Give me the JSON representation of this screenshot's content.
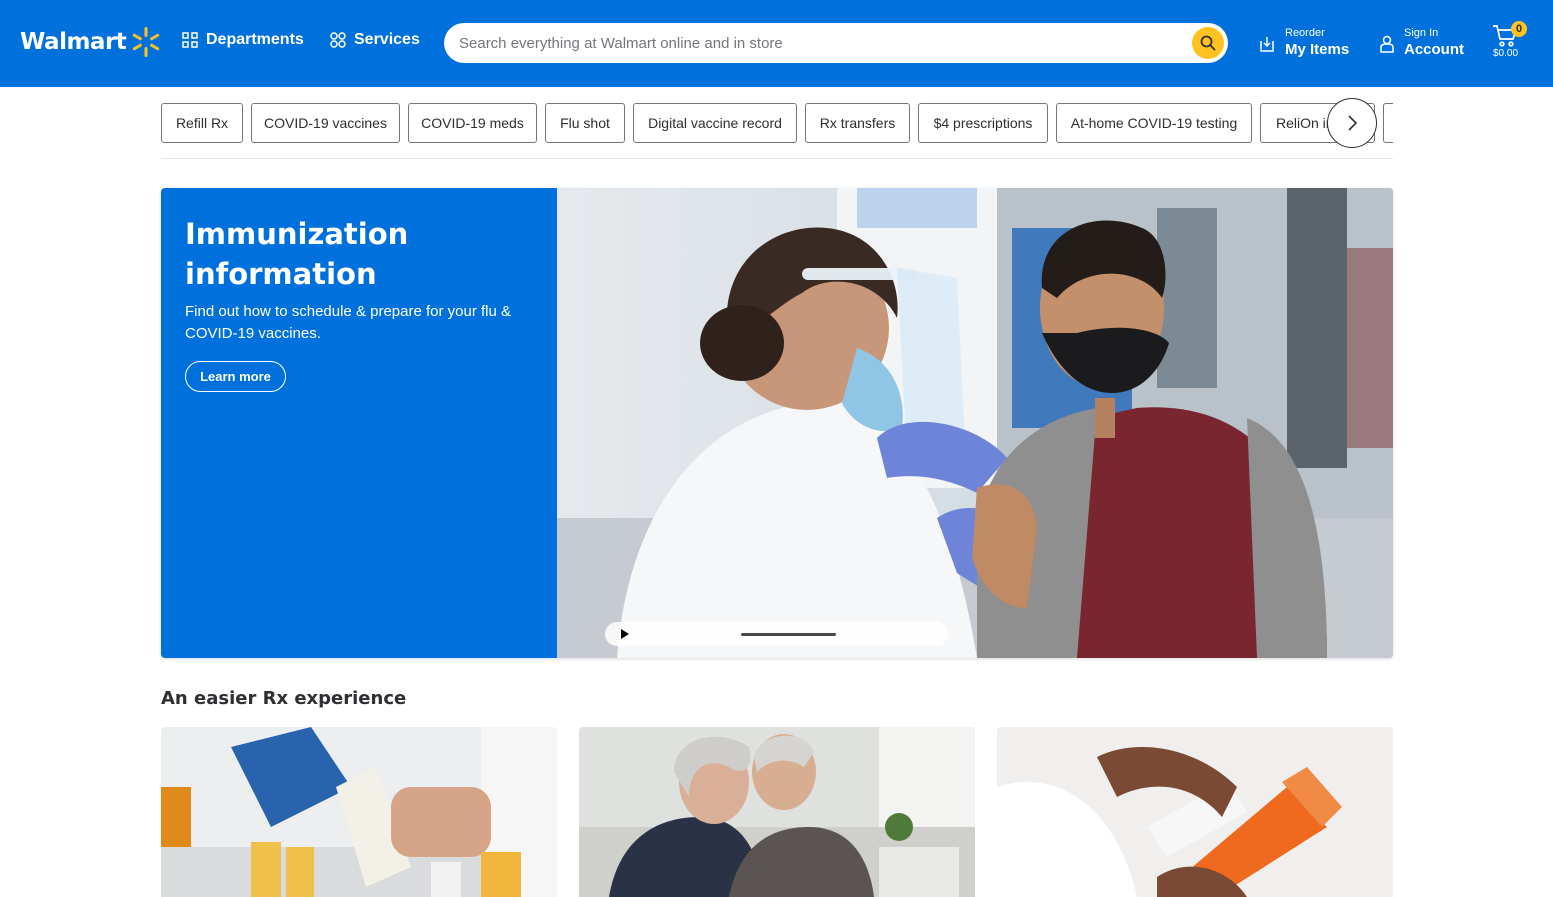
{
  "header": {
    "logo_text": "Walmart",
    "departments_label": "Departments",
    "services_label": "Services",
    "search_placeholder": "Search everything at Walmart online and in store",
    "reorder_small": "Reorder",
    "reorder_big": "My Items",
    "signin_small": "Sign In",
    "signin_big": "Account",
    "cart_count": "0",
    "cart_total": "$0.00",
    "brand_color": "#0071dc",
    "spark_color": "#ffc220"
  },
  "chips": [
    {
      "label": "Refill Rx"
    },
    {
      "label": "COVID-19 vaccines"
    },
    {
      "label": "COVID-19 meds"
    },
    {
      "label": "Flu shot"
    },
    {
      "label": "Digital vaccine record"
    },
    {
      "label": "Rx transfers"
    },
    {
      "label": "$4 prescriptions"
    },
    {
      "label": "At-home COVID-19 testing"
    },
    {
      "label": "ReliOn insulin"
    }
  ],
  "hero": {
    "title": "Immunization information",
    "subtitle": "Find out how to schedule & prepare for your flu & COVID-19 vaccines.",
    "cta_label": "Learn more"
  },
  "section": {
    "title": "An easier Rx experience"
  }
}
